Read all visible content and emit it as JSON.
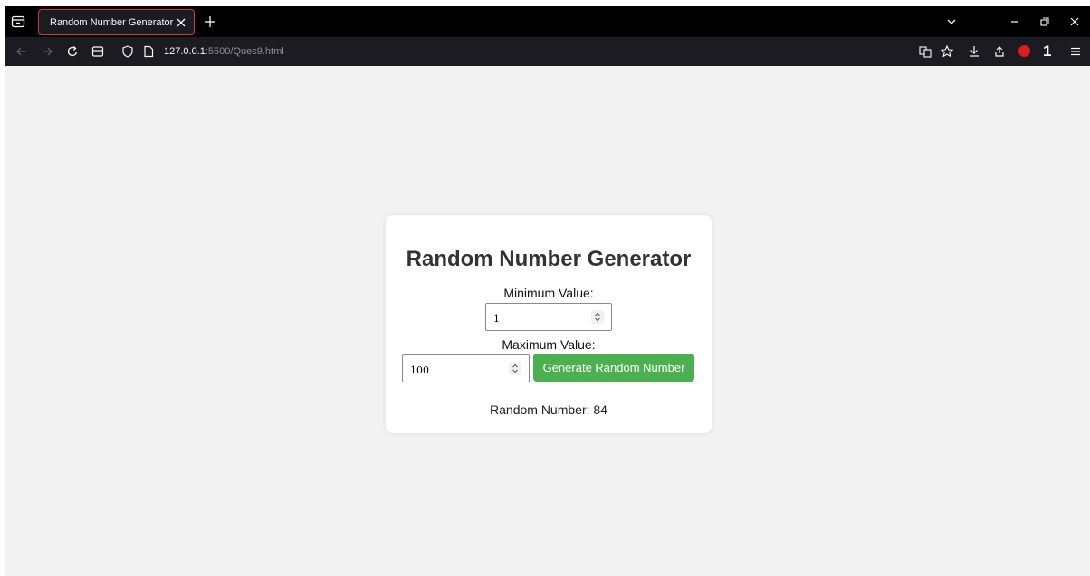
{
  "browser": {
    "tab": {
      "title": "Random Number Generator"
    },
    "url": {
      "host": "127.0.0.1",
      "path": ":5500/Ques9.html"
    },
    "account_badge": "1"
  },
  "page": {
    "title": "Random Number Generator",
    "min_label": "Minimum Value:",
    "min_value": "1",
    "max_label": "Maximum Value:",
    "max_value": "100",
    "generate_label": "Generate Random Number",
    "result_label": "Random Number: 84",
    "colors": {
      "button": "#4caf50",
      "background": "#f2f2f2",
      "card": "#ffffff"
    }
  }
}
